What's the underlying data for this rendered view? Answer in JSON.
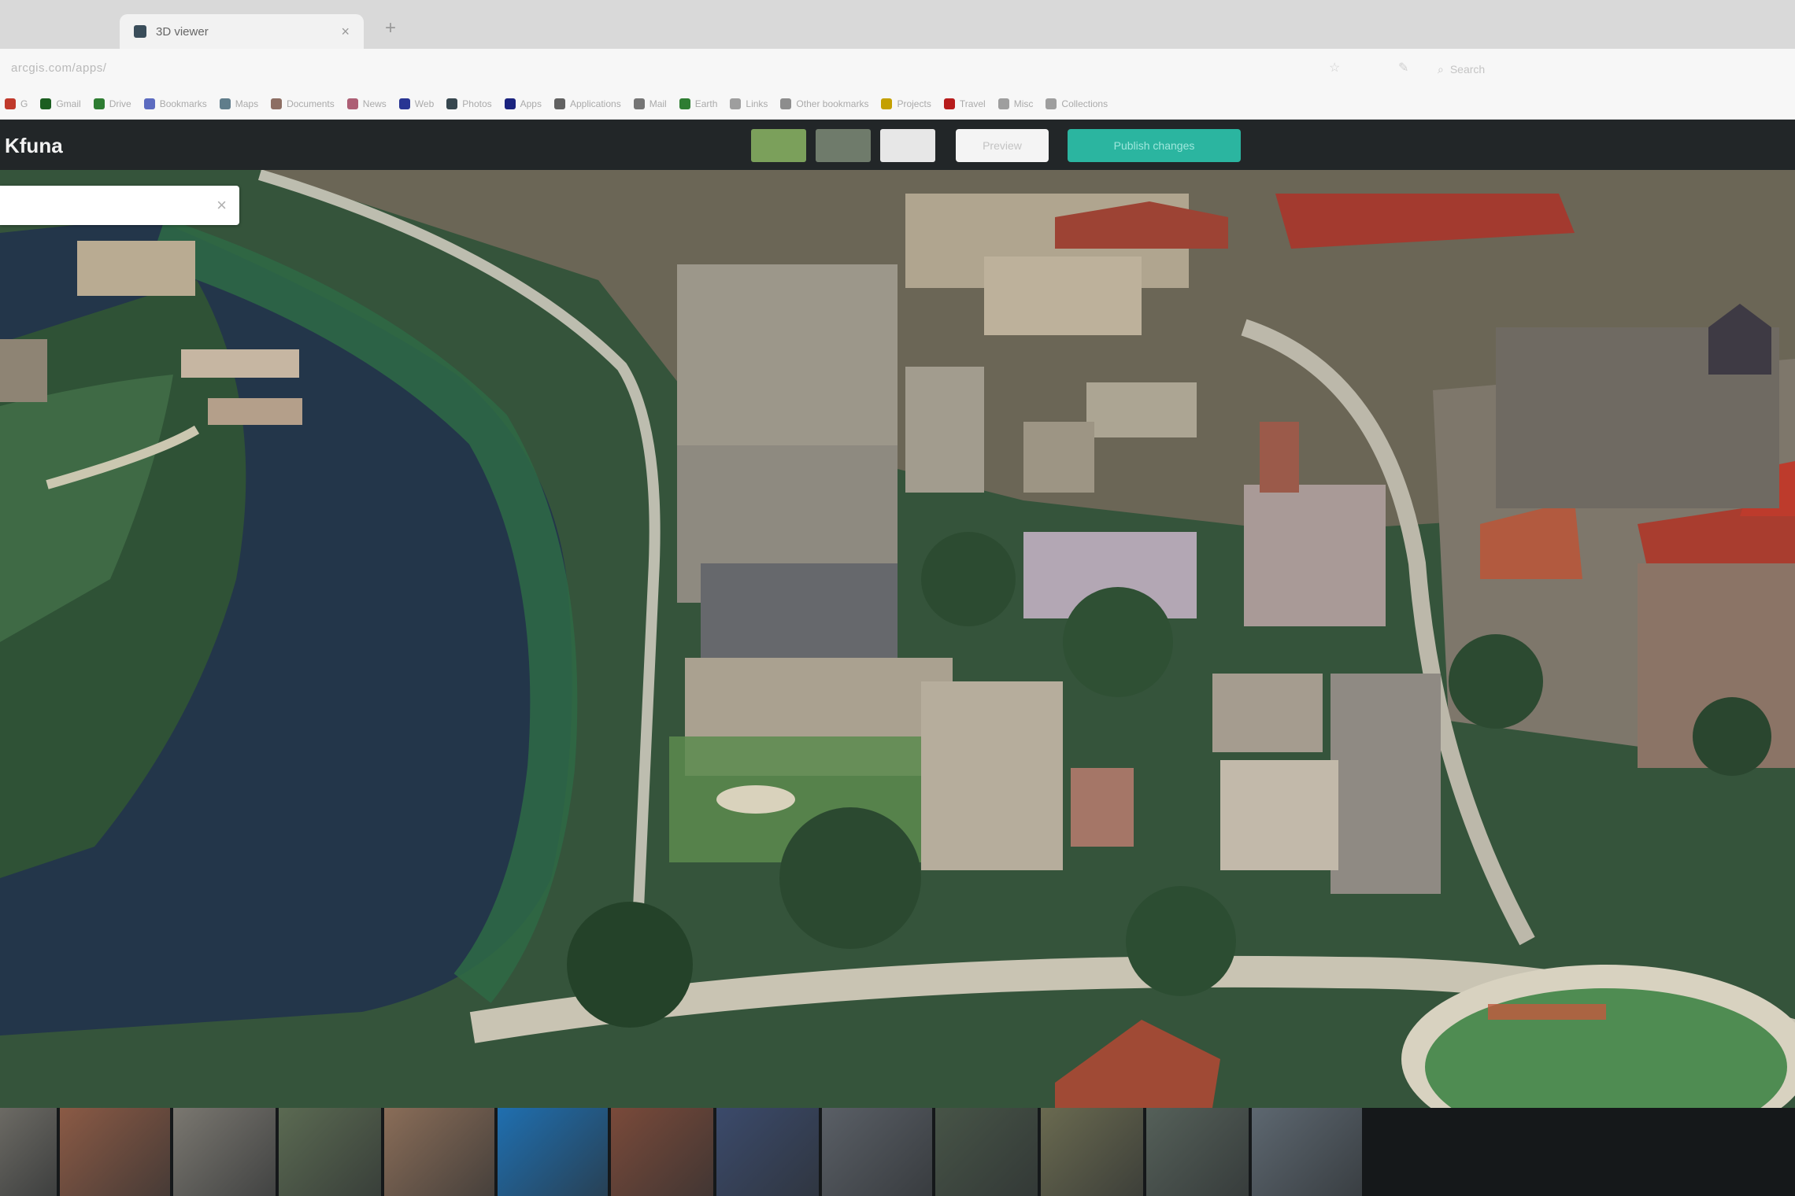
{
  "browser": {
    "tab_title": "3D viewer",
    "url_text": "arcgis.com/apps/",
    "toolbar_search": "Search",
    "bookmarks": [
      {
        "label": "G",
        "color": "#c0392b"
      },
      {
        "label": "Gmail",
        "color": "#1b5e20"
      },
      {
        "label": "Drive",
        "color": "#2e7d32"
      },
      {
        "label": "Bookmarks",
        "color": "#5c6bc0"
      },
      {
        "label": "Maps",
        "color": "#607d8b"
      },
      {
        "label": "Documents",
        "color": "#8d6e63"
      },
      {
        "label": "News",
        "color": "#ad5f75"
      },
      {
        "label": "Web",
        "color": "#283593"
      },
      {
        "label": "Photos",
        "color": "#37474f"
      },
      {
        "label": "Apps",
        "color": "#1a237e"
      },
      {
        "label": "Applications",
        "color": "#616161"
      },
      {
        "label": "Mail",
        "color": "#757575"
      },
      {
        "label": "Earth",
        "color": "#2e7d32"
      },
      {
        "label": "Links",
        "color": "#9e9e9e"
      },
      {
        "label": "Other bookmarks",
        "color": "#8d8d8d"
      },
      {
        "label": "Projects",
        "color": "#c4a000"
      },
      {
        "label": "Travel",
        "color": "#b71c1c"
      },
      {
        "label": "Misc",
        "color": "#9e9e9e"
      },
      {
        "label": "Collections",
        "color": "#9e9e9e"
      }
    ]
  },
  "app": {
    "brand": "Kfuna",
    "toolbar_buttons": [
      {
        "name": "layer-green",
        "color": "#7ba05b"
      },
      {
        "name": "layer-gray",
        "color": "#6f7b6b"
      },
      {
        "name": "layer-white",
        "color": "#e7e7e7"
      }
    ],
    "preview_button": "Preview",
    "publish_button": "Publish changes",
    "accent_color": "#2bb5a0"
  },
  "map": {
    "search_placeholder": "",
    "search_icon": "close-icon"
  },
  "filmstrip": {
    "thumbnails": [
      {
        "name": "thumb-1",
        "color": "#6c6a64"
      },
      {
        "name": "thumb-2",
        "color": "#8b5a45"
      },
      {
        "name": "thumb-3",
        "color": "#7a7770"
      },
      {
        "name": "thumb-4",
        "color": "#5b6a52"
      },
      {
        "name": "thumb-5",
        "color": "#8a6d58"
      },
      {
        "name": "thumb-6",
        "color": "#1f6fb0"
      },
      {
        "name": "thumb-7",
        "color": "#7a4a3a"
      },
      {
        "name": "thumb-8",
        "color": "#3b4a6b"
      },
      {
        "name": "thumb-9",
        "color": "#5a5f66"
      },
      {
        "name": "thumb-10",
        "color": "#475447"
      },
      {
        "name": "thumb-11",
        "color": "#6a6a50"
      },
      {
        "name": "thumb-12",
        "color": "#556059"
      },
      {
        "name": "thumb-13",
        "color": "#5d6770"
      }
    ]
  }
}
